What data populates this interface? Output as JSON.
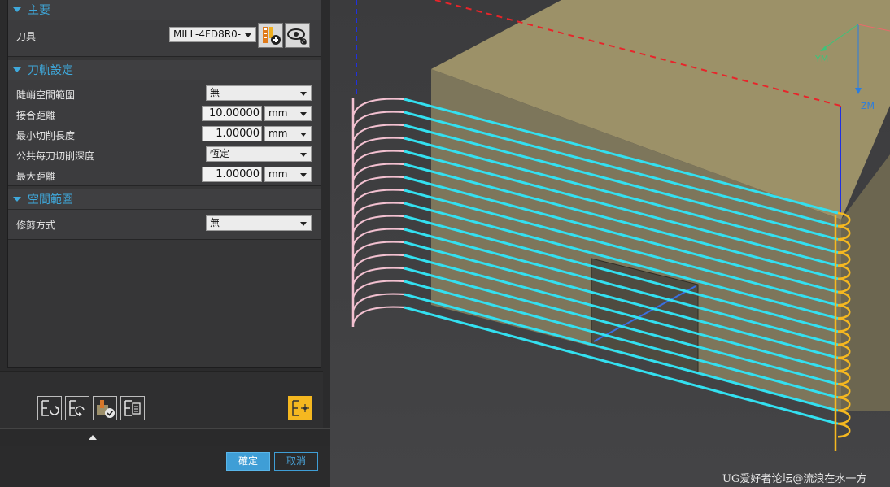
{
  "sections": {
    "main": {
      "title": "主要",
      "tool_label": "刀具",
      "tool_value": "MILL-4FD8R0-"
    },
    "toolpath": {
      "title": "刀軌設定",
      "rows": [
        {
          "label": "陡峭空間範圍",
          "value": "無"
        },
        {
          "label": "接合距離",
          "value": "10.00000",
          "unit": "mm"
        },
        {
          "label": "最小切削長度",
          "value": "1.00000",
          "unit": "mm"
        },
        {
          "label": "公共每刀切削深度",
          "value": "恆定"
        },
        {
          "label": "最大距離",
          "value": "1.00000",
          "unit": "mm"
        }
      ]
    },
    "range": {
      "title": "空間範圍",
      "trim_label": "修剪方式",
      "trim_value": "無"
    }
  },
  "buttons": {
    "ok": "確定",
    "cancel": "取消"
  },
  "axes": {
    "ym": "YM",
    "zm": "ZM"
  },
  "watermark": "UG爱好者论坛@流浪在水一方",
  "colors": {
    "accent": "#3fa9dc",
    "toolpath": "#33e0f0",
    "lead_in": "#f2c0d0",
    "lead_out": "#f5b820"
  }
}
